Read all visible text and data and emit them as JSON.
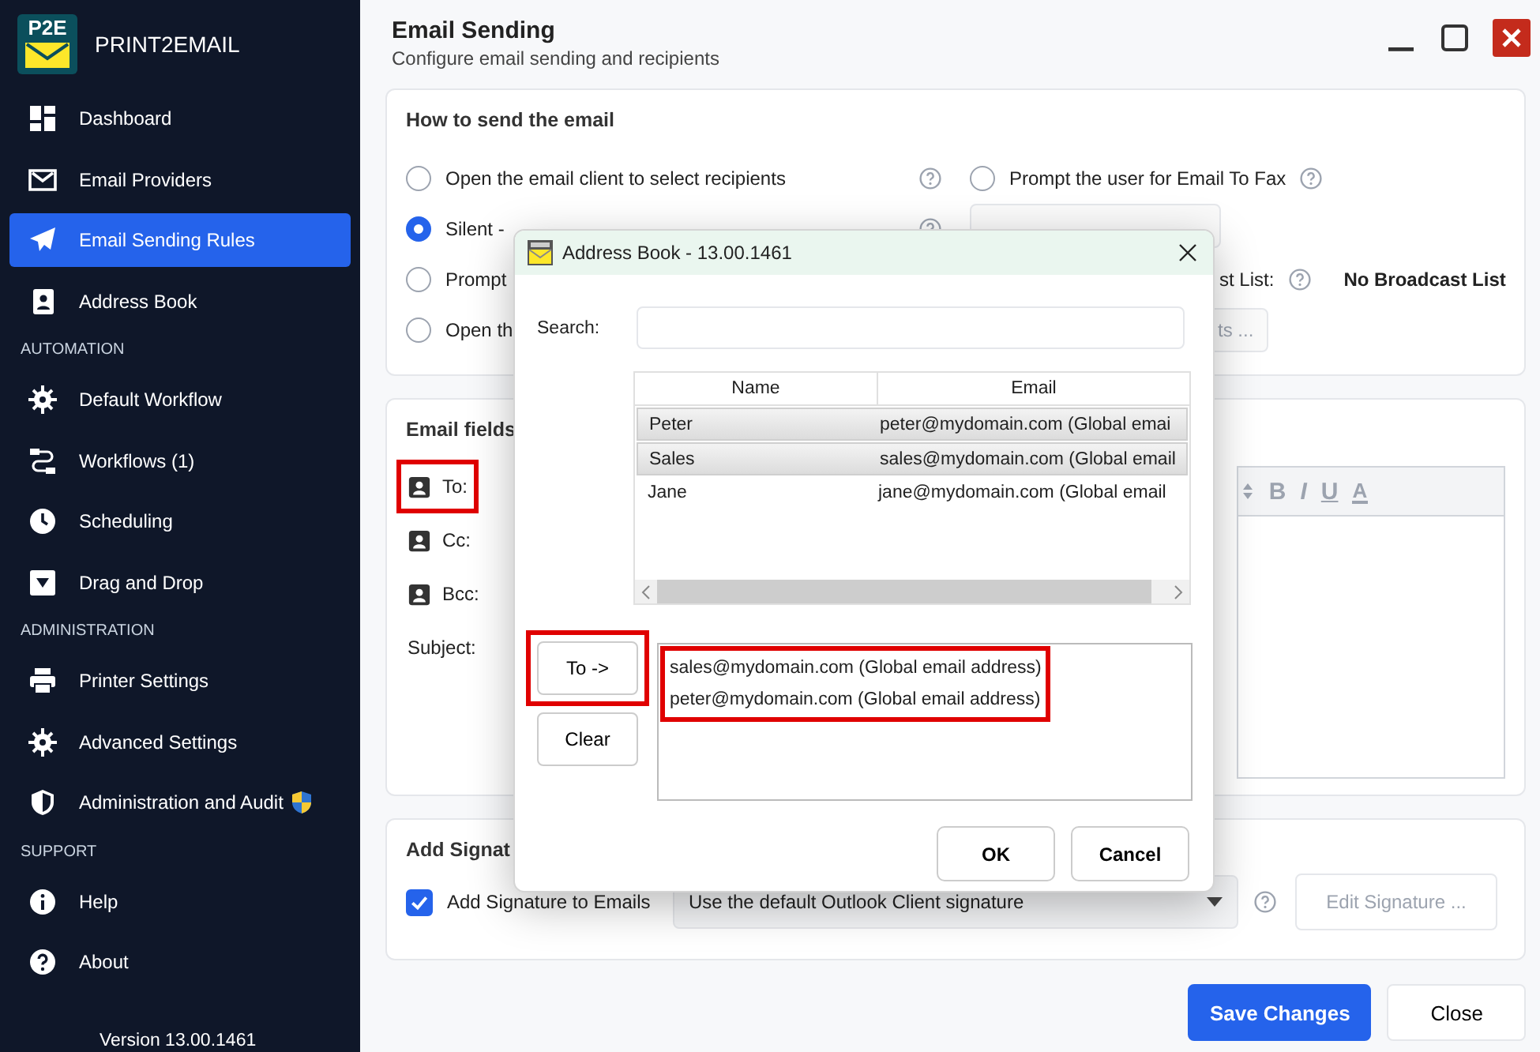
{
  "app": {
    "logo": "P2E",
    "name": "PRINT2EMAIL",
    "version": "Version 13.00.1461"
  },
  "sidebar": {
    "items": [
      {
        "kind": "item",
        "label": "Dashboard",
        "selected": false
      },
      {
        "kind": "item",
        "label": "Email Providers",
        "selected": false
      },
      {
        "kind": "item",
        "label": "Email Sending Rules",
        "selected": true
      },
      {
        "kind": "item",
        "label": "Address Book",
        "selected": false
      },
      {
        "kind": "section",
        "label": "AUTOMATION"
      },
      {
        "kind": "item",
        "label": "Default Workflow",
        "selected": false
      },
      {
        "kind": "item",
        "label": "Workflows (1)",
        "selected": false
      },
      {
        "kind": "item",
        "label": "Scheduling",
        "selected": false
      },
      {
        "kind": "item",
        "label": "Drag and Drop",
        "selected": false
      },
      {
        "kind": "section",
        "label": "ADMINISTRATION"
      },
      {
        "kind": "item",
        "label": "Printer Settings",
        "selected": false
      },
      {
        "kind": "item",
        "label": "Advanced Settings",
        "selected": false
      },
      {
        "kind": "item",
        "label": "Administration and Audit",
        "selected": false
      },
      {
        "kind": "section",
        "label": "SUPPORT"
      },
      {
        "kind": "item",
        "label": "Help",
        "selected": false
      },
      {
        "kind": "item",
        "label": "About",
        "selected": false
      }
    ]
  },
  "header": {
    "title": "Email Sending",
    "subtitle": "Configure email sending and recipients"
  },
  "send_card": {
    "heading": "How to send the email",
    "options": [
      {
        "label": "Open the email client to select recipients",
        "selected": false,
        "help": true
      },
      {
        "label": "Silent -",
        "selected": true,
        "help": true
      },
      {
        "label": "Prompt",
        "selected": false,
        "help": false
      },
      {
        "label": "Open th",
        "selected": false,
        "help": false
      }
    ],
    "fax_option": {
      "label": "Prompt the user for Email To Fax",
      "selected": false
    },
    "broadcast_label": "st List:",
    "broadcast_value": "No Broadcast List",
    "broadcast_button": "ts ..."
  },
  "fields_card": {
    "heading": "Email fields",
    "fields": [
      {
        "kind": "contact",
        "label": "To:",
        "highlighted": true
      },
      {
        "kind": "contact",
        "label": "Cc:",
        "highlighted": false
      },
      {
        "kind": "contact",
        "label": "Bcc:",
        "highlighted": false
      },
      {
        "kind": "plain",
        "label": "Subject:",
        "highlighted": false
      }
    ],
    "toolbar": [
      "B",
      "I",
      "U",
      "A"
    ]
  },
  "signature_card": {
    "heading": "Add Signat",
    "checkbox": {
      "label": "Add Signature to Emails",
      "checked": true
    },
    "select": "Use the default Outlook Client signature",
    "edit_button": "Edit Signature ...",
    "edit_disabled": true
  },
  "footer": {
    "buttons": [
      {
        "label": "Save Changes",
        "kind": "primary"
      },
      {
        "label": "Close",
        "kind": "secondary"
      }
    ]
  },
  "dialog": {
    "title": "Address Book - 13.00.1461",
    "search_label": "Search:",
    "columns": [
      "Name",
      "Email"
    ],
    "rows": [
      {
        "name": "Peter",
        "email": "peter@mydomain.com (Global emai",
        "selected": true
      },
      {
        "name": "Sales",
        "email": "sales@mydomain.com (Global email",
        "selected": true
      },
      {
        "name": "Jane",
        "email": "jane@mydomain.com (Global email",
        "selected": false
      }
    ],
    "to_button": {
      "label": "To ->",
      "highlighted": true
    },
    "clear_button": "Clear",
    "recipients": [
      "sales@mydomain.com (Global email address)",
      "peter@mydomain.com (Global email address)"
    ],
    "recipients_highlighted": true,
    "buttons": [
      "OK",
      "Cancel"
    ]
  }
}
